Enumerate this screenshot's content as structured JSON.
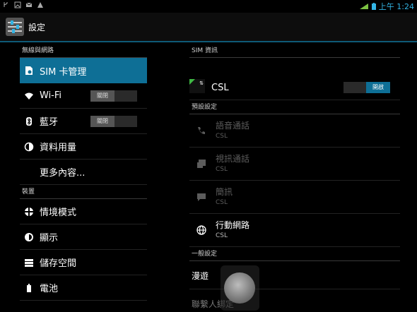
{
  "status_bar": {
    "time": "上午 1:24"
  },
  "action_bar": {
    "title": "設定"
  },
  "left": {
    "sections": [
      {
        "header": "無線與網路"
      },
      {
        "header": "裝置"
      }
    ],
    "items_wireless": [
      {
        "label": "SIM 卡管理"
      },
      {
        "label": "Wi-Fi",
        "toggle": "關閉"
      },
      {
        "label": "藍牙",
        "toggle": "關閉"
      },
      {
        "label": "資料用量"
      },
      {
        "label": "更多內容..."
      }
    ],
    "items_device": [
      {
        "label": "情境模式"
      },
      {
        "label": "顯示"
      },
      {
        "label": "儲存空間"
      },
      {
        "label": "電池"
      }
    ]
  },
  "right": {
    "sim_section": "SIM 資訊",
    "sim_name": "CSL",
    "sim_toggle": "開啟",
    "default_section": "預設設定",
    "defaults": [
      {
        "title": "語音通話",
        "sub": "CSL"
      },
      {
        "title": "視訊通話",
        "sub": "CSL"
      },
      {
        "title": "簡訊",
        "sub": "CSL"
      },
      {
        "title": "行動網路",
        "sub": "CSL"
      }
    ],
    "general_section": "一般設定",
    "roaming": "漫遊",
    "contacts_bind": "聯繫人綁定"
  },
  "colors": {
    "accent": "#0e6f96",
    "sim_green": "#3fb944"
  }
}
